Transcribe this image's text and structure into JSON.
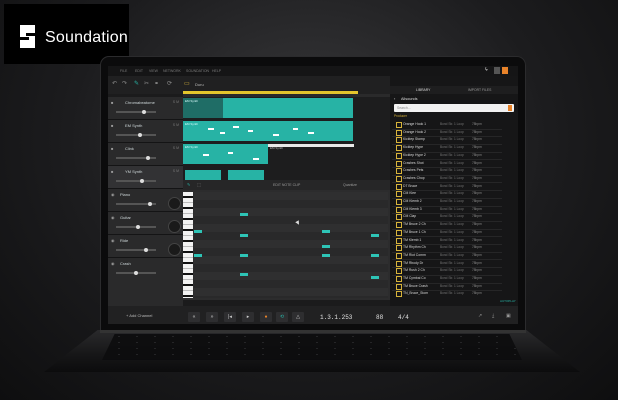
{
  "brand": {
    "name": "Soundation",
    "logo_icon": "soundation-s-logo"
  },
  "menu": [
    "FILE",
    "EDIT",
    "VIEW",
    "NETWORK",
    "SOUNDATION",
    "HELP"
  ],
  "project_tab": {
    "label": "Duru"
  },
  "tracks": [
    {
      "name": "Chromabeatome",
      "type": "instrument"
    },
    {
      "name": "EM Synth",
      "type": "instrument"
    },
    {
      "name": "Clink",
      "type": "instrument"
    },
    {
      "name": "YM Synth",
      "type": "instrument"
    },
    {
      "name": "Piano",
      "type": "drum"
    },
    {
      "name": "Guitar",
      "type": "drum"
    },
    {
      "name": "Ride",
      "type": "drum"
    },
    {
      "name": "Crash",
      "type": "drum"
    }
  ],
  "clips": {
    "label_1": "EM Synth",
    "label_2": "EM Synth",
    "label_3": "EM Synth",
    "label_4": "EM Synth"
  },
  "editor": {
    "title": "EDIT NOTE CLIP",
    "quantize": "Quantize"
  },
  "browser": {
    "tabs": [
      "LIBRARY",
      "IMPORT FILES"
    ],
    "back_label": "Allsounds",
    "search_placeholder": "Search...",
    "section_label": "Producer",
    "items": [
      {
        "name": "Orange Hook 1",
        "meta": "Bond Str. 1 Loop",
        "tempo": "78bpm"
      },
      {
        "name": "Orange Hook 2",
        "meta": "Bond Str. 1 Loop",
        "tempo": "78bpm"
      },
      {
        "name": "Kicktep Stomp",
        "meta": "Bond Str. 1 Loop",
        "tempo": "78bpm"
      },
      {
        "name": "Kicktep Hype",
        "meta": "Bond Str. 1 Loop",
        "tempo": "78bpm"
      },
      {
        "name": "Kicktep Hype 2",
        "meta": "Bond Str. 1 Loop",
        "tempo": "78bpm"
      },
      {
        "name": "Crashes Shot",
        "meta": "Bond Str. 1 Loop",
        "tempo": "78bpm"
      },
      {
        "name": "Crashes Pets",
        "meta": "Bond Str. 1 Loop",
        "tempo": "78bpm"
      },
      {
        "name": "Crashes Chop",
        "meta": "Bond Str. 1 Loop",
        "tempo": "78bpm"
      },
      {
        "name": "DT Bruce",
        "meta": "Bond Str. 1 Loop",
        "tempo": "78bpm"
      },
      {
        "name": "CM Klee",
        "meta": "Bond Str. 1 Loop",
        "tempo": "78bpm"
      },
      {
        "name": "CM Klemb 2",
        "meta": "Bond Str. 1 Loop",
        "tempo": "78bpm"
      },
      {
        "name": "CM Klemb 3",
        "meta": "Bond Str. 1 Loop",
        "tempo": "78bpm"
      },
      {
        "name": "CM Clap",
        "meta": "Bond Str. 1 Loop",
        "tempo": "78bpm"
      },
      {
        "name": "TM Bruce 2 Ch",
        "meta": "Bond Str. 1 Loop",
        "tempo": "78bpm"
      },
      {
        "name": "TM Bruce 1 Ch",
        "meta": "Bond Str. 1 Loop",
        "tempo": "78bpm"
      },
      {
        "name": "TM Klemb 1",
        "meta": "Bond Str. 1 Loop",
        "tempo": "78bpm"
      },
      {
        "name": "TM Rhythm Ch",
        "meta": "Bond Str. 1 Loop",
        "tempo": "78bpm"
      },
      {
        "name": "TM Riot Comm",
        "meta": "Bond Str. 1 Loop",
        "tempo": "78bpm"
      },
      {
        "name": "TM Rbody Dr",
        "meta": "Bond Str. 1 Loop",
        "tempo": "78bpm"
      },
      {
        "name": "TM Rush 2 Ch",
        "meta": "Bond Str. 1 Loop",
        "tempo": "78bpm"
      },
      {
        "name": "TM Cymbal Co",
        "meta": "Bond Str. 1 Loop",
        "tempo": "78bpm"
      },
      {
        "name": "TM Bruce Crash",
        "meta": "Bond Str. 1 Loop",
        "tempo": "78bpm"
      },
      {
        "name": "TN_Bruce_Stom",
        "meta": "Bond Str. 1 Loop",
        "tempo": "78bpm"
      }
    ],
    "footer": "AUTOPLAY"
  },
  "transport": {
    "add_channel": "+ Add Channel",
    "position": "1.3.1.253",
    "tempo": "88",
    "signature": "4/4"
  },
  "colors": {
    "accent_teal": "#27b3a5",
    "playhead_yellow": "#e4c52c",
    "record_orange": "#e8832a",
    "folder_yellow": "#d7b33a"
  }
}
